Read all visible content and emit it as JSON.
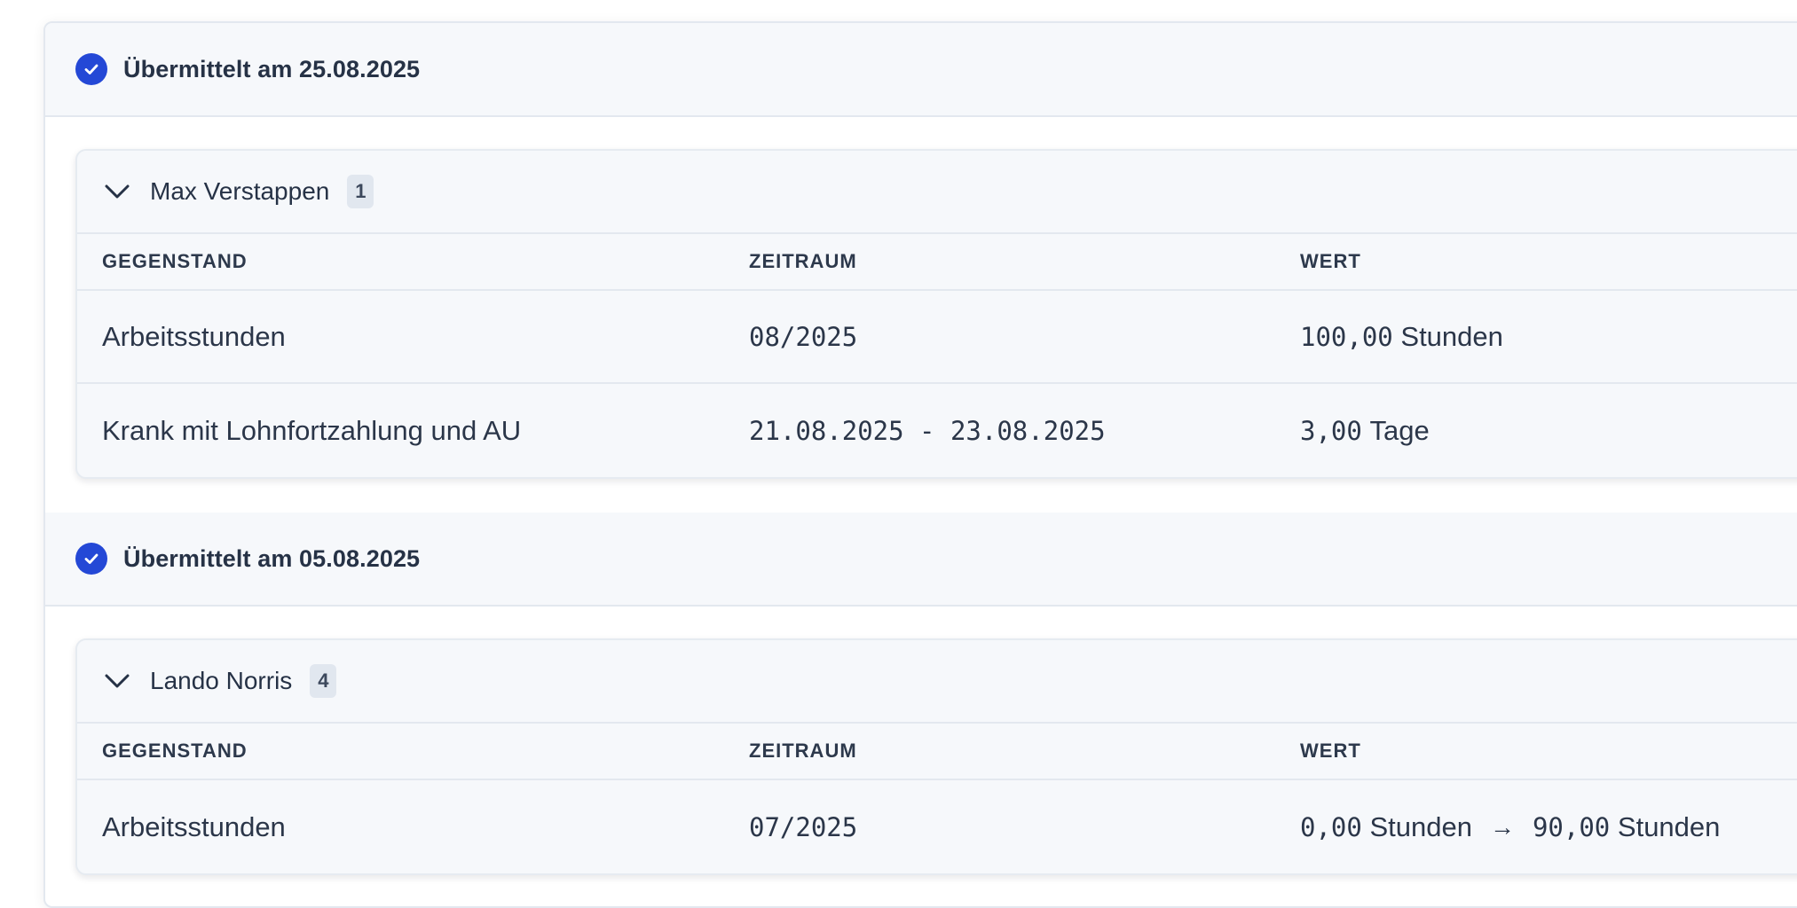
{
  "sections": [
    {
      "status": "Übermittelt am 25.08.2025",
      "group": {
        "name": "Max Verstappen",
        "count": "1",
        "headers": [
          "GEGENSTAND",
          "ZEITRAUM",
          "WERT"
        ],
        "rows": [
          {
            "item": "Arbeitsstunden",
            "period": "08/2025",
            "value_num": "100,00",
            "value_unit": "Stunden"
          },
          {
            "item": "Krank mit Lohnfortzahlung und AU",
            "period": "21.08.2025 - 23.08.2025",
            "value_num": "3,00",
            "value_unit": "Tage"
          }
        ]
      }
    },
    {
      "status": "Übermittelt am 05.08.2025",
      "group": {
        "name": "Lando Norris",
        "count": "4",
        "headers": [
          "GEGENSTAND",
          "ZEITRAUM",
          "WERT"
        ],
        "rows": [
          {
            "item": "Arbeitsstunden",
            "period": "07/2025",
            "value_old_num": "0,00",
            "value_old_unit": "Stunden",
            "arrow": "→",
            "value_num": "90,00",
            "value_unit": "Stunden"
          }
        ]
      }
    }
  ],
  "icons": {
    "status": "check-circle-icon",
    "expand": "chevron-down-icon"
  },
  "colors": {
    "accent": "#2448d6",
    "header_bg": "#f6f8fb",
    "border": "#e3e8ef"
  }
}
